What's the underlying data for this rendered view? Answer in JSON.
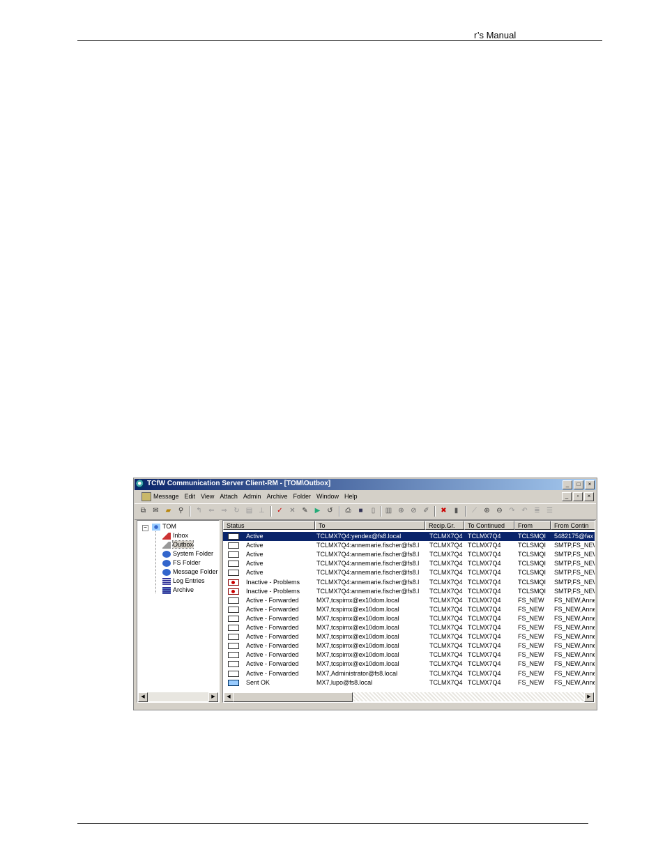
{
  "page_header": {
    "text": "r’s Manual"
  },
  "window": {
    "title": "TCfW Communication Server Client-RM - [TOM\\Outbox]",
    "title_buttons": [
      "_",
      "□",
      "×"
    ],
    "mdi_buttons": [
      "_",
      "▫",
      "×"
    ],
    "menus": [
      "Message",
      "Edit",
      "View",
      "Attach",
      "Admin",
      "Archive",
      "Folder",
      "Window",
      "Help"
    ],
    "tree": [
      {
        "label": "TOM",
        "icon": "network-icon",
        "level": 0
      },
      {
        "label": "Inbox",
        "icon": "inbox-icon",
        "level": 1
      },
      {
        "label": "Outbox",
        "icon": "outbox-icon",
        "level": 1,
        "selected": true
      },
      {
        "label": "System Folder",
        "icon": "globe-icon",
        "level": 1
      },
      {
        "label": "FS Folder",
        "icon": "globe-icon",
        "level": 1
      },
      {
        "label": "Message Folder",
        "icon": "globe-icon",
        "level": 1
      },
      {
        "label": "Log Entries",
        "icon": "log-icon",
        "level": 1
      },
      {
        "label": "Archive",
        "icon": "archive-icon",
        "level": 1
      }
    ],
    "columns": [
      "Status",
      "To",
      "Recip.Gr.",
      "To Continued",
      "From",
      "From Contin"
    ],
    "rows": [
      {
        "icon": "envelope",
        "status": "Active",
        "to": "TCLMX7Q4:yendex@fs8.local",
        "recip": "TCLMX7Q4",
        "to_cont": "TCLMX7Q4",
        "from": "TCLSMQI",
        "from_cont": "5482175@fax",
        "selected": true
      },
      {
        "icon": "envelope",
        "status": "Active",
        "to": "TCLMX7Q4:annemarie.fischer@fs8.l",
        "recip": "TCLMX7Q4",
        "to_cont": "TCLMX7Q4",
        "from": "TCLSMQI",
        "from_cont": "SMTP,FS_NEW"
      },
      {
        "icon": "envelope",
        "status": "Active",
        "to": "TCLMX7Q4:annemarie.fischer@fs8.l",
        "recip": "TCLMX7Q4",
        "to_cont": "TCLMX7Q4",
        "from": "TCLSMQI",
        "from_cont": "SMTP,FS_NEW"
      },
      {
        "icon": "envelope",
        "status": "Active",
        "to": "TCLMX7Q4:annemarie.fischer@fs8.l",
        "recip": "TCLMX7Q4",
        "to_cont": "TCLMX7Q4",
        "from": "TCLSMQI",
        "from_cont": "SMTP,FS_NEW"
      },
      {
        "icon": "envelope",
        "status": "Active",
        "to": "TCLMX7Q4:annemarie.fischer@fs8.l",
        "recip": "TCLMX7Q4",
        "to_cont": "TCLMX7Q4",
        "from": "TCLSMQI",
        "from_cont": "SMTP,FS_NEW"
      },
      {
        "icon": "problem",
        "status": "Inactive - Problems",
        "to": "TCLMX7Q4:annemarie.fischer@fs8.l",
        "recip": "TCLMX7Q4",
        "to_cont": "TCLMX7Q4",
        "from": "TCLSMQI",
        "from_cont": "SMTP,FS_NEW"
      },
      {
        "icon": "problem",
        "status": "Inactive - Problems",
        "to": "TCLMX7Q4:annemarie.fischer@fs8.l",
        "recip": "TCLMX7Q4",
        "to_cont": "TCLMX7Q4",
        "from": "TCLSMQI",
        "from_cont": "SMTP,FS_NEW"
      },
      {
        "icon": "envelope",
        "status": "Active - Forwarded",
        "to": "MX7,tcspimx@ex10dom.local",
        "recip": "TCLMX7Q4",
        "to_cont": "TCLMX7Q4",
        "from": "FS_NEW",
        "from_cont": "FS_NEW,Anne"
      },
      {
        "icon": "envelope",
        "status": "Active - Forwarded",
        "to": "MX7,tcspimx@ex10dom.local",
        "recip": "TCLMX7Q4",
        "to_cont": "TCLMX7Q4",
        "from": "FS_NEW",
        "from_cont": "FS_NEW,Anne"
      },
      {
        "icon": "envelope",
        "status": "Active - Forwarded",
        "to": "MX7,tcspimx@ex10dom.local",
        "recip": "TCLMX7Q4",
        "to_cont": "TCLMX7Q4",
        "from": "FS_NEW",
        "from_cont": "FS_NEW,Anne"
      },
      {
        "icon": "envelope",
        "status": "Active - Forwarded",
        "to": "MX7,tcspimx@ex10dom.local",
        "recip": "TCLMX7Q4",
        "to_cont": "TCLMX7Q4",
        "from": "FS_NEW",
        "from_cont": "FS_NEW,Anne"
      },
      {
        "icon": "envelope",
        "status": "Active - Forwarded",
        "to": "MX7,tcspimx@ex10dom.local",
        "recip": "TCLMX7Q4",
        "to_cont": "TCLMX7Q4",
        "from": "FS_NEW",
        "from_cont": "FS_NEW,Anne"
      },
      {
        "icon": "envelope",
        "status": "Active - Forwarded",
        "to": "MX7,tcspimx@ex10dom.local",
        "recip": "TCLMX7Q4",
        "to_cont": "TCLMX7Q4",
        "from": "FS_NEW",
        "from_cont": "FS_NEW,Anne"
      },
      {
        "icon": "envelope",
        "status": "Active - Forwarded",
        "to": "MX7,tcspimx@ex10dom.local",
        "recip": "TCLMX7Q4",
        "to_cont": "TCLMX7Q4",
        "from": "FS_NEW",
        "from_cont": "FS_NEW,Anne"
      },
      {
        "icon": "envelope",
        "status": "Active - Forwarded",
        "to": "MX7,tcspimx@ex10dom.local",
        "recip": "TCLMX7Q4",
        "to_cont": "TCLMX7Q4",
        "from": "FS_NEW",
        "from_cont": "FS_NEW,Anne"
      },
      {
        "icon": "envelope",
        "status": "Active - Forwarded",
        "to": "MX7,Administrator@fs8.local",
        "recip": "TCLMX7Q4",
        "to_cont": "TCLMX7Q4",
        "from": "FS_NEW",
        "from_cont": "FS_NEW,Anne"
      },
      {
        "icon": "sent",
        "status": "Sent OK",
        "to": "MX7,lupo@fs8.local",
        "recip": "TCLMX7Q4",
        "to_cont": "TCLMX7Q4",
        "from": "FS_NEW",
        "from_cont": "FS_NEW,Anne"
      }
    ],
    "colors": {
      "title_start": "#0a246a",
      "title_end": "#a6caf0",
      "selection": "#0a246a",
      "face": "#d4d0c8"
    }
  }
}
